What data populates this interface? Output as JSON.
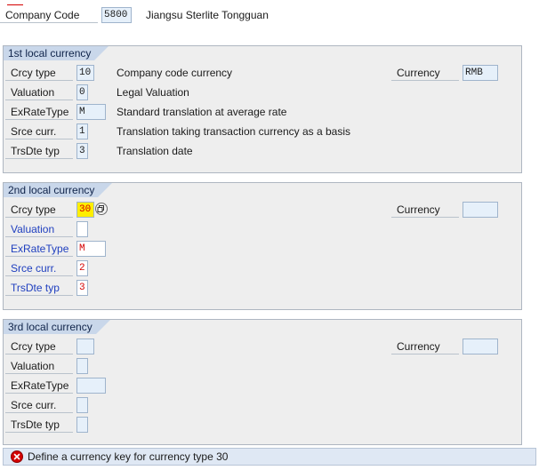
{
  "header": {
    "company_code_label": "Company Code",
    "company_code_value": "5800",
    "company_name": "Jiangsu Sterlite Tongguan"
  },
  "groups": [
    {
      "title": "1st local currency",
      "rows": [
        {
          "label": "Crcy type",
          "value": "10",
          "desc": "Company code currency"
        },
        {
          "label": "Valuation",
          "value": "0",
          "desc": "Legal Valuation"
        },
        {
          "label": "ExRateType",
          "value": "M",
          "desc": "Standard translation at average rate"
        },
        {
          "label": "Srce curr.",
          "value": "1",
          "desc": "Translation taking transaction currency as a basis"
        },
        {
          "label": "TrsDte typ",
          "value": "3",
          "desc": "Translation date"
        }
      ],
      "currency_label": "Currency",
      "currency_value": "RMB"
    },
    {
      "title": "2nd local currency",
      "rows": [
        {
          "label": "Crcy type",
          "value": "30"
        },
        {
          "label": "Valuation",
          "value": ""
        },
        {
          "label": "ExRateType",
          "value": "M"
        },
        {
          "label": "Srce curr.",
          "value": "2"
        },
        {
          "label": "TrsDte typ",
          "value": "3"
        }
      ],
      "currency_label": "Currency",
      "currency_value": ""
    },
    {
      "title": "3rd local currency",
      "rows": [
        {
          "label": "Crcy type",
          "value": ""
        },
        {
          "label": "Valuation",
          "value": ""
        },
        {
          "label": "ExRateType",
          "value": ""
        },
        {
          "label": "Srce curr.",
          "value": ""
        },
        {
          "label": "TrsDte typ",
          "value": ""
        }
      ],
      "currency_label": "Currency",
      "currency_value": ""
    }
  ],
  "status_bar": {
    "message": "Define a currency key for currency type 30",
    "type_icon": "error-icon"
  },
  "colors": {
    "highlight": "#ffee00",
    "error_red": "#d40000",
    "link_blue": "#1f3fbf"
  }
}
